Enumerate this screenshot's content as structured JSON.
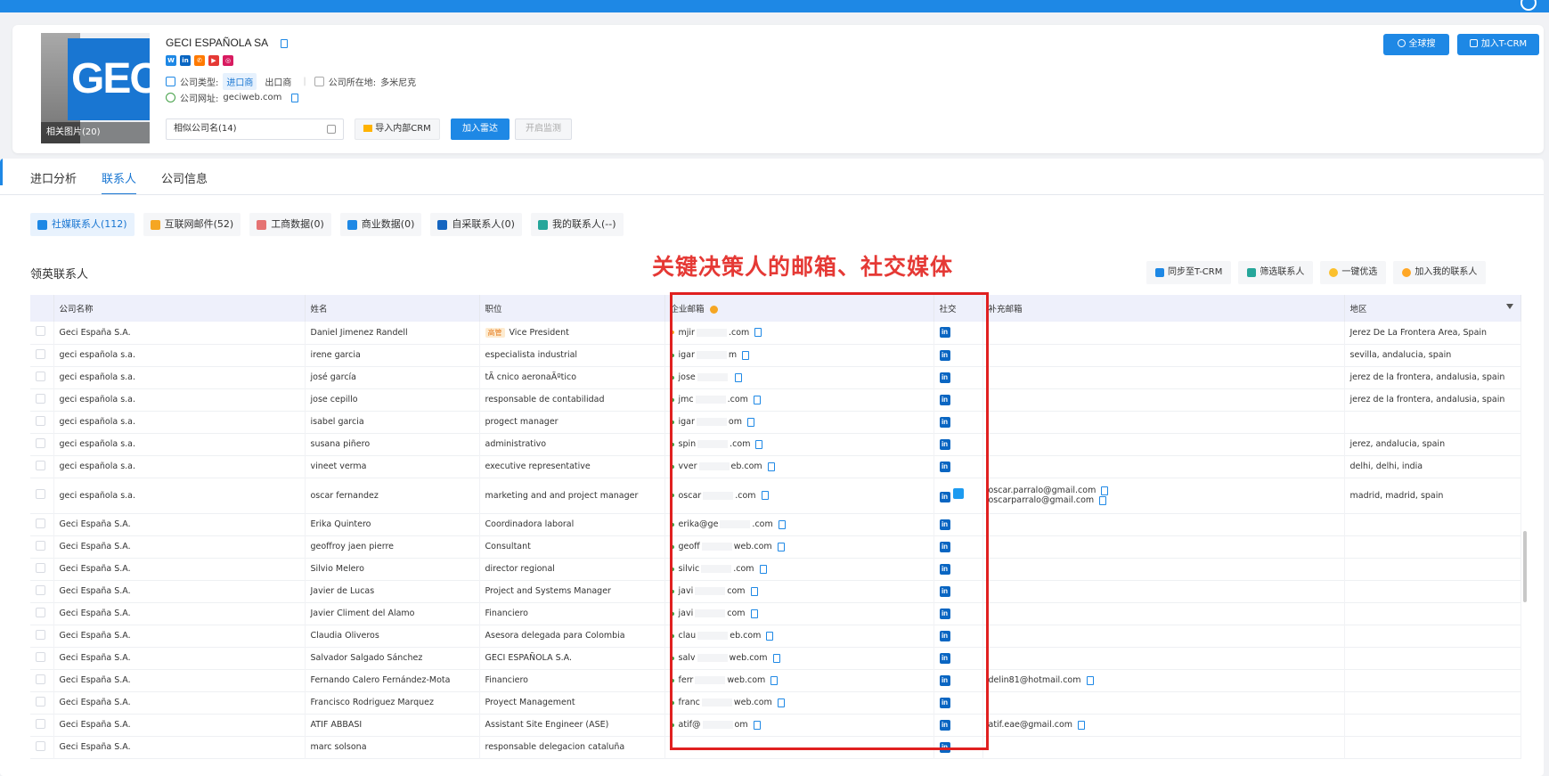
{
  "company": {
    "name": "GECI ESPAÑOLA SA",
    "logo_text": "GECI",
    "photos_label": "相关图片(20)",
    "type_label": "公司类型:",
    "type_active": "进口商",
    "type_other": "出口商",
    "location_label": "公司所在地:",
    "location_value": "多米尼克",
    "website_label": "公司网址:",
    "website_value": "geciweb.com",
    "similar_label": "相似公司名(14)",
    "import_crm": "导入内部CRM",
    "add_radar": "加入雷达",
    "monitor": "开启监测",
    "global_search": "全球搜",
    "add_tcrm": "加入T-CRM",
    "social_icons": [
      "website-icon",
      "linkedin-icon",
      "phone-icon",
      "youtube-icon",
      "instagram-icon"
    ]
  },
  "tabs": [
    "进口分析",
    "联系人",
    "公司信息"
  ],
  "subtabs": [
    {
      "label": "社媒联系人(112)",
      "color": "#1e88e5"
    },
    {
      "label": "互联网邮件(52)",
      "color": "#f5a623"
    },
    {
      "label": "工商数据(0)",
      "color": "#e57373"
    },
    {
      "label": "商业数据(0)",
      "color": "#1e88e5"
    },
    {
      "label": "自采联系人(0)",
      "color": "#1565c0"
    },
    {
      "label": "我的联系人(--)",
      "color": "#26a69a"
    }
  ],
  "section_title": "领英联系人",
  "annotation": "关键决策人的邮箱、社交媒体",
  "actions": [
    "同步至T-CRM",
    "筛选联系人",
    "一键优选",
    "加入我的联系人"
  ],
  "table": {
    "headers": [
      "公司名称",
      "姓名",
      "职位",
      "企业邮箱",
      "社交",
      "补充邮箱",
      "地区"
    ],
    "rows": [
      {
        "company": "Geci España S.A.",
        "name": "Daniel Jimenez Randell",
        "tag": "高管",
        "title": "Vice President",
        "email_a": "mjir",
        "email_b": ".com",
        "dot": "#f5a623",
        "social": [
          "in"
        ],
        "extra": [],
        "region": "Jerez De La Frontera Area, Spain"
      },
      {
        "company": "geci española s.a.",
        "name": "irene garcia",
        "title": "especialista industrial",
        "email_a": "igar",
        "email_b": "m",
        "dot": "#43a047",
        "social": [
          "in"
        ],
        "extra": [],
        "region": "sevilla, andalucia, spain"
      },
      {
        "company": "geci española s.a.",
        "name": "josé garcía",
        "title": "tÃ cnico aeronaÃºtico",
        "email_a": "jose",
        "email_b": "",
        "dot": "#43a047",
        "social": [
          "in"
        ],
        "extra": [],
        "region": "jerez de la frontera, andalusia, spain"
      },
      {
        "company": "geci española s.a.",
        "name": "jose cepillo",
        "title": "responsable de contabilidad",
        "email_a": "jmc",
        "email_b": ".com",
        "dot": "#43a047",
        "social": [
          "in"
        ],
        "extra": [],
        "region": "jerez de la frontera, andalusia, spain"
      },
      {
        "company": "geci española s.a.",
        "name": "isabel garcia",
        "title": "progect manager",
        "email_a": "igar",
        "email_b": "om",
        "dot": "#43a047",
        "social": [
          "in"
        ],
        "extra": [],
        "region": ""
      },
      {
        "company": "geci española s.a.",
        "name": "susana piñero",
        "title": "administrativo",
        "email_a": "spin",
        "email_b": ".com",
        "dot": "#43a047",
        "social": [
          "in"
        ],
        "extra": [],
        "region": "jerez, andalucia, spain"
      },
      {
        "company": "geci española s.a.",
        "name": "vineet verma",
        "title": "executive representative",
        "email_a": "vver",
        "email_b": "eb.com",
        "dot": "#43a047",
        "social": [
          "in"
        ],
        "extra": [],
        "region": "delhi, delhi, india"
      },
      {
        "company": "geci española s.a.",
        "name": "oscar fernandez",
        "title": "marketing and and project manager",
        "email_a": "oscar",
        "email_b": ".com",
        "dot": "#43a047",
        "social": [
          "in",
          "tw"
        ],
        "extra": [
          "oscar.parralo@gmail.com",
          "oscarparralo@gmail.com"
        ],
        "region": "madrid, madrid, spain"
      },
      {
        "company": "Geci España S.A.",
        "name": "Erika Quintero",
        "title": "Coordinadora laboral",
        "email_a": "erika@ge",
        "email_b": ".com",
        "dot": "#43a047",
        "social": [
          "in"
        ],
        "extra": [],
        "region": ""
      },
      {
        "company": "Geci España S.A.",
        "name": "geoffroy jaen pierre",
        "title": "Consultant",
        "email_a": "geoff",
        "email_b": "web.com",
        "dot": "#43a047",
        "social": [
          "in"
        ],
        "extra": [],
        "region": ""
      },
      {
        "company": "Geci España S.A.",
        "name": "Silvio Melero",
        "title": "director regional",
        "email_a": "silvic",
        "email_b": ".com",
        "dot": "#43a047",
        "social": [
          "in"
        ],
        "extra": [],
        "region": ""
      },
      {
        "company": "Geci España S.A.",
        "name": "Javier de Lucas",
        "title": "Project and Systems Manager",
        "email_a": "javi",
        "email_b": "com",
        "dot": "#43a047",
        "social": [
          "in"
        ],
        "extra": [],
        "region": ""
      },
      {
        "company": "Geci España S.A.",
        "name": "Javier Climent del Alamo",
        "title": "Financiero",
        "email_a": "javi",
        "email_b": "com",
        "dot": "#43a047",
        "social": [
          "in"
        ],
        "extra": [],
        "region": ""
      },
      {
        "company": "Geci España S.A.",
        "name": "Claudia Oliveros",
        "title": "Asesora delegada para Colombia",
        "email_a": "clau",
        "email_b": "eb.com",
        "dot": "#43a047",
        "social": [
          "in"
        ],
        "extra": [],
        "region": ""
      },
      {
        "company": "Geci España S.A.",
        "name": "Salvador Salgado Sánchez",
        "title": "GECI ESPAÑOLA S.A.",
        "email_a": "salv",
        "email_b": "web.com",
        "dot": "#43a047",
        "social": [
          "in"
        ],
        "extra": [],
        "region": ""
      },
      {
        "company": "Geci España S.A.",
        "name": "Fernando Calero Fernández-Mota",
        "title": "Financiero",
        "email_a": "ferr",
        "email_b": "web.com",
        "dot": "#43a047",
        "social": [
          "in"
        ],
        "extra": [
          "delin81@hotmail.com"
        ],
        "region": ""
      },
      {
        "company": "Geci España S.A.",
        "name": "Francisco Rodriguez Marquez",
        "title": "Proyect Management",
        "email_a": "franc",
        "email_b": "web.com",
        "dot": "#43a047",
        "social": [
          "in"
        ],
        "extra": [],
        "region": ""
      },
      {
        "company": "Geci España S.A.",
        "name": "ATIF ABBASI",
        "title": "Assistant Site Engineer (ASE)",
        "email_a": "atif@",
        "email_b": "om",
        "dot": "#43a047",
        "social": [
          "in"
        ],
        "extra": [
          "atif.eae@gmail.com"
        ],
        "region": ""
      },
      {
        "company": "Geci España S.A.",
        "name": "marc solsona",
        "title": "responsable delegacion cataluña",
        "email_a": "",
        "email_b": "",
        "dot": "#43a047",
        "social": [
          "in"
        ],
        "extra": [],
        "region": ""
      }
    ]
  }
}
